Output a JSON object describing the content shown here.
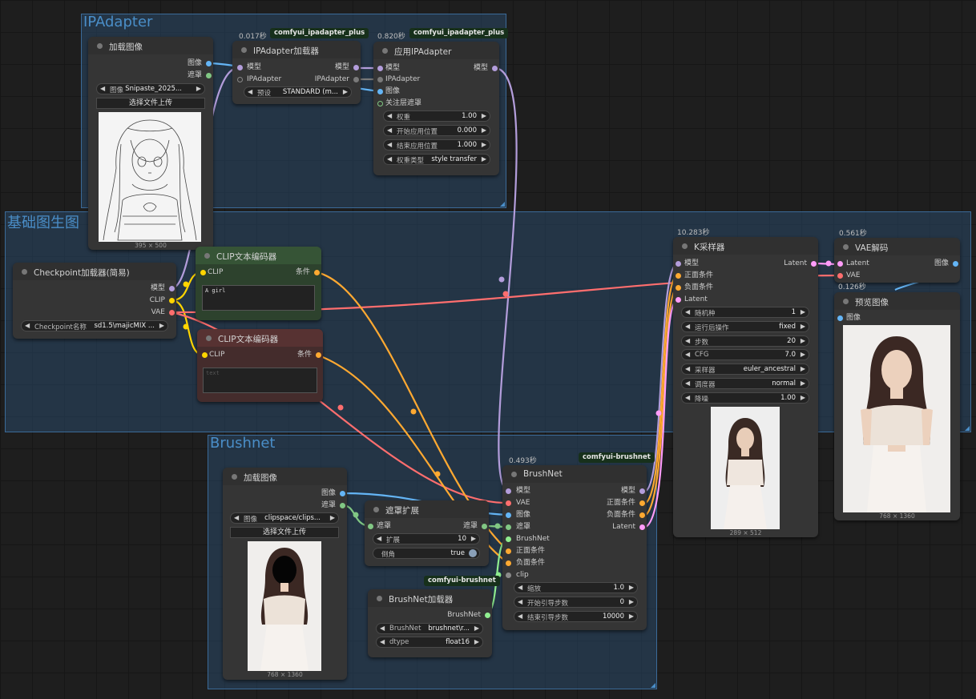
{
  "groups": {
    "ipadapter": "IPAdapter",
    "basic": "基础图生图",
    "brushnet": "Brushnet"
  },
  "colors": {
    "model": "#b39ddb",
    "clip": "#ffd500",
    "vae": "#ff6e6e",
    "image": "#64b5f6",
    "mask": "#81c784",
    "cond": "#ffa931",
    "latent": "#ff9cf9",
    "ipadapter": "#7a7a7a",
    "brushnet": "#90ee90"
  },
  "load_image_ip": {
    "title": "加载图像",
    "out_image": "图像",
    "out_mask": "遮罩",
    "image_name": "图像",
    "image_value": "Snipaste_2025...",
    "upload_btn": "选择文件上传",
    "dims": "395 × 500"
  },
  "ipa_loader": {
    "time": "0.017秒",
    "badge": "comfyui_ipadapter_plus",
    "title": "IPAdapter加载器",
    "in_model": "模型",
    "in_ipadapter": "IPAdapter",
    "out_model": "模型",
    "out_ipadapter": "IPAdapter",
    "preset_name": "预设",
    "preset_value": "STANDARD (m..."
  },
  "apply_ipa": {
    "time": "0.820秒",
    "badge": "comfyui_ipadapter_plus",
    "title": "应用IPAdapter",
    "in_model": "模型",
    "in_ipadapter": "IPAdapter",
    "in_image": "图像",
    "in_attn": "关注层遮罩",
    "out_model": "模型",
    "widgets": [
      {
        "name": "权重",
        "value": "1.00"
      },
      {
        "name": "开始应用位置",
        "value": "0.000"
      },
      {
        "name": "结束应用位置",
        "value": "1.000"
      },
      {
        "name": "权重类型",
        "value": "style transfer"
      }
    ]
  },
  "checkpoint": {
    "title": "Checkpoint加载器(简易)",
    "out_model": "模型",
    "out_clip": "CLIP",
    "out_vae": "VAE",
    "ckpt_name": "Checkpoint名称",
    "ckpt_value": "sd1.5\\majicMIX ..."
  },
  "clip_pos": {
    "title": "CLIP文本编码器",
    "in_clip": "CLIP",
    "out_cond": "条件",
    "text": "A girl"
  },
  "clip_neg": {
    "title": "CLIP文本编码器",
    "in_clip": "CLIP",
    "out_cond": "条件",
    "placeholder": "text"
  },
  "ksampler": {
    "time": "10.283秒",
    "title": "K采样器",
    "in_model": "模型",
    "in_pos": "正面条件",
    "in_neg": "负面条件",
    "in_latent": "Latent",
    "out_latent": "Latent",
    "widgets": [
      {
        "name": "随机种",
        "value": "1"
      },
      {
        "name": "运行后操作",
        "value": "fixed"
      },
      {
        "name": "步数",
        "value": "20"
      },
      {
        "name": "CFG",
        "value": "7.0"
      },
      {
        "name": "采样器",
        "value": "euler_ancestral"
      },
      {
        "name": "调度器",
        "value": "normal"
      },
      {
        "name": "降噪",
        "value": "1.00"
      }
    ],
    "dims": "289 × 512"
  },
  "vae_decode": {
    "time": "0.561秒",
    "title": "VAE解码",
    "in_latent": "Latent",
    "in_vae": "VAE",
    "out_image": "图像"
  },
  "preview": {
    "time": "0.126秒",
    "title": "预览图像",
    "in_image": "图像",
    "dims": "768 × 1360"
  },
  "load_image_bn": {
    "title": "加载图像",
    "out_image": "图像",
    "out_mask": "遮罩",
    "image_name": "图像",
    "image_value": "clipspace/clips...",
    "upload_btn": "选择文件上传",
    "dims": "768 × 1360"
  },
  "mask_expand": {
    "title": "遮罩扩展",
    "in_mask": "遮罩",
    "out_mask": "遮罩",
    "expand_name": "扩展",
    "expand_value": "10",
    "taper_name": "倒角",
    "taper_value": "true"
  },
  "brushnet": {
    "time": "0.493秒",
    "badge": "comfyui-brushnet",
    "title": "BrushNet",
    "inputs": [
      "模型",
      "VAE",
      "图像",
      "遮罩",
      "BrushNet",
      "正面条件",
      "负面条件",
      "clip"
    ],
    "outputs": [
      "模型",
      "正面条件",
      "负面条件",
      "Latent"
    ],
    "widgets": [
      {
        "name": "缩放",
        "value": "1.0"
      },
      {
        "name": "开始引导步数",
        "value": "0"
      },
      {
        "name": "结束引导步数",
        "value": "10000"
      }
    ]
  },
  "brushnet_loader": {
    "badge": "comfyui-brushnet",
    "title": "BrushNet加载器",
    "out_brushnet": "BrushNet",
    "bn_name": "BrushNet",
    "bn_value": "brushnet\\r...",
    "dtype_name": "dtype",
    "dtype_value": "float16"
  }
}
